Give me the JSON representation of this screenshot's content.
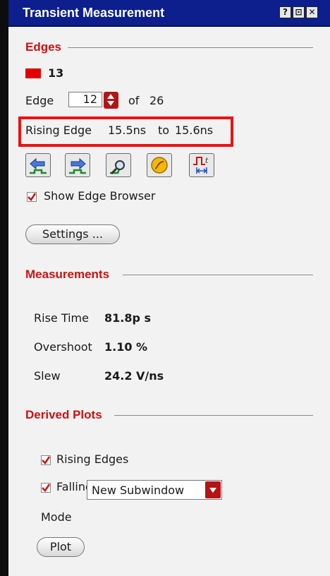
{
  "window": {
    "title": "Transient Measurement",
    "buttons": {
      "help": "?",
      "restore": "⊡",
      "close": "✕"
    }
  },
  "edges": {
    "section_title": "Edges",
    "swatch_color": "#e00000",
    "edge_count": "13",
    "edge_label": "Edge",
    "edge_value": "12",
    "of_label": "of",
    "total_edges": "26",
    "edge_type": "Rising Edge",
    "start_time": "15.5ns",
    "to_label": "to",
    "end_time": "15.6ns",
    "toolbar_icons": [
      "prev-edge-icon",
      "next-edge-icon",
      "zoom-edge-icon",
      "measure-icon",
      "edge-timing-icon"
    ],
    "show_browser_label": "Show Edge Browser",
    "show_browser_checked": true,
    "settings_label": "Settings ..."
  },
  "measurements": {
    "section_title": "Measurements",
    "rows": [
      {
        "label": "Rise Time",
        "value": "81.8p s"
      },
      {
        "label": "Overshoot",
        "value": "1.10 %"
      },
      {
        "label": "Slew",
        "value": "24.2 V/ns"
      }
    ]
  },
  "derived": {
    "section_title": "Derived Plots",
    "rising_label": "Rising Edges",
    "rising_checked": true,
    "falling_label": "Falling Edges",
    "falling_checked": true,
    "mode_label": "Mode",
    "mode_value": "New Subwindow",
    "plot_label": "Plot"
  },
  "colors": {
    "titlebar": "#0c1f8d",
    "accent": "#cc1111",
    "highlight": "#ee1111"
  }
}
